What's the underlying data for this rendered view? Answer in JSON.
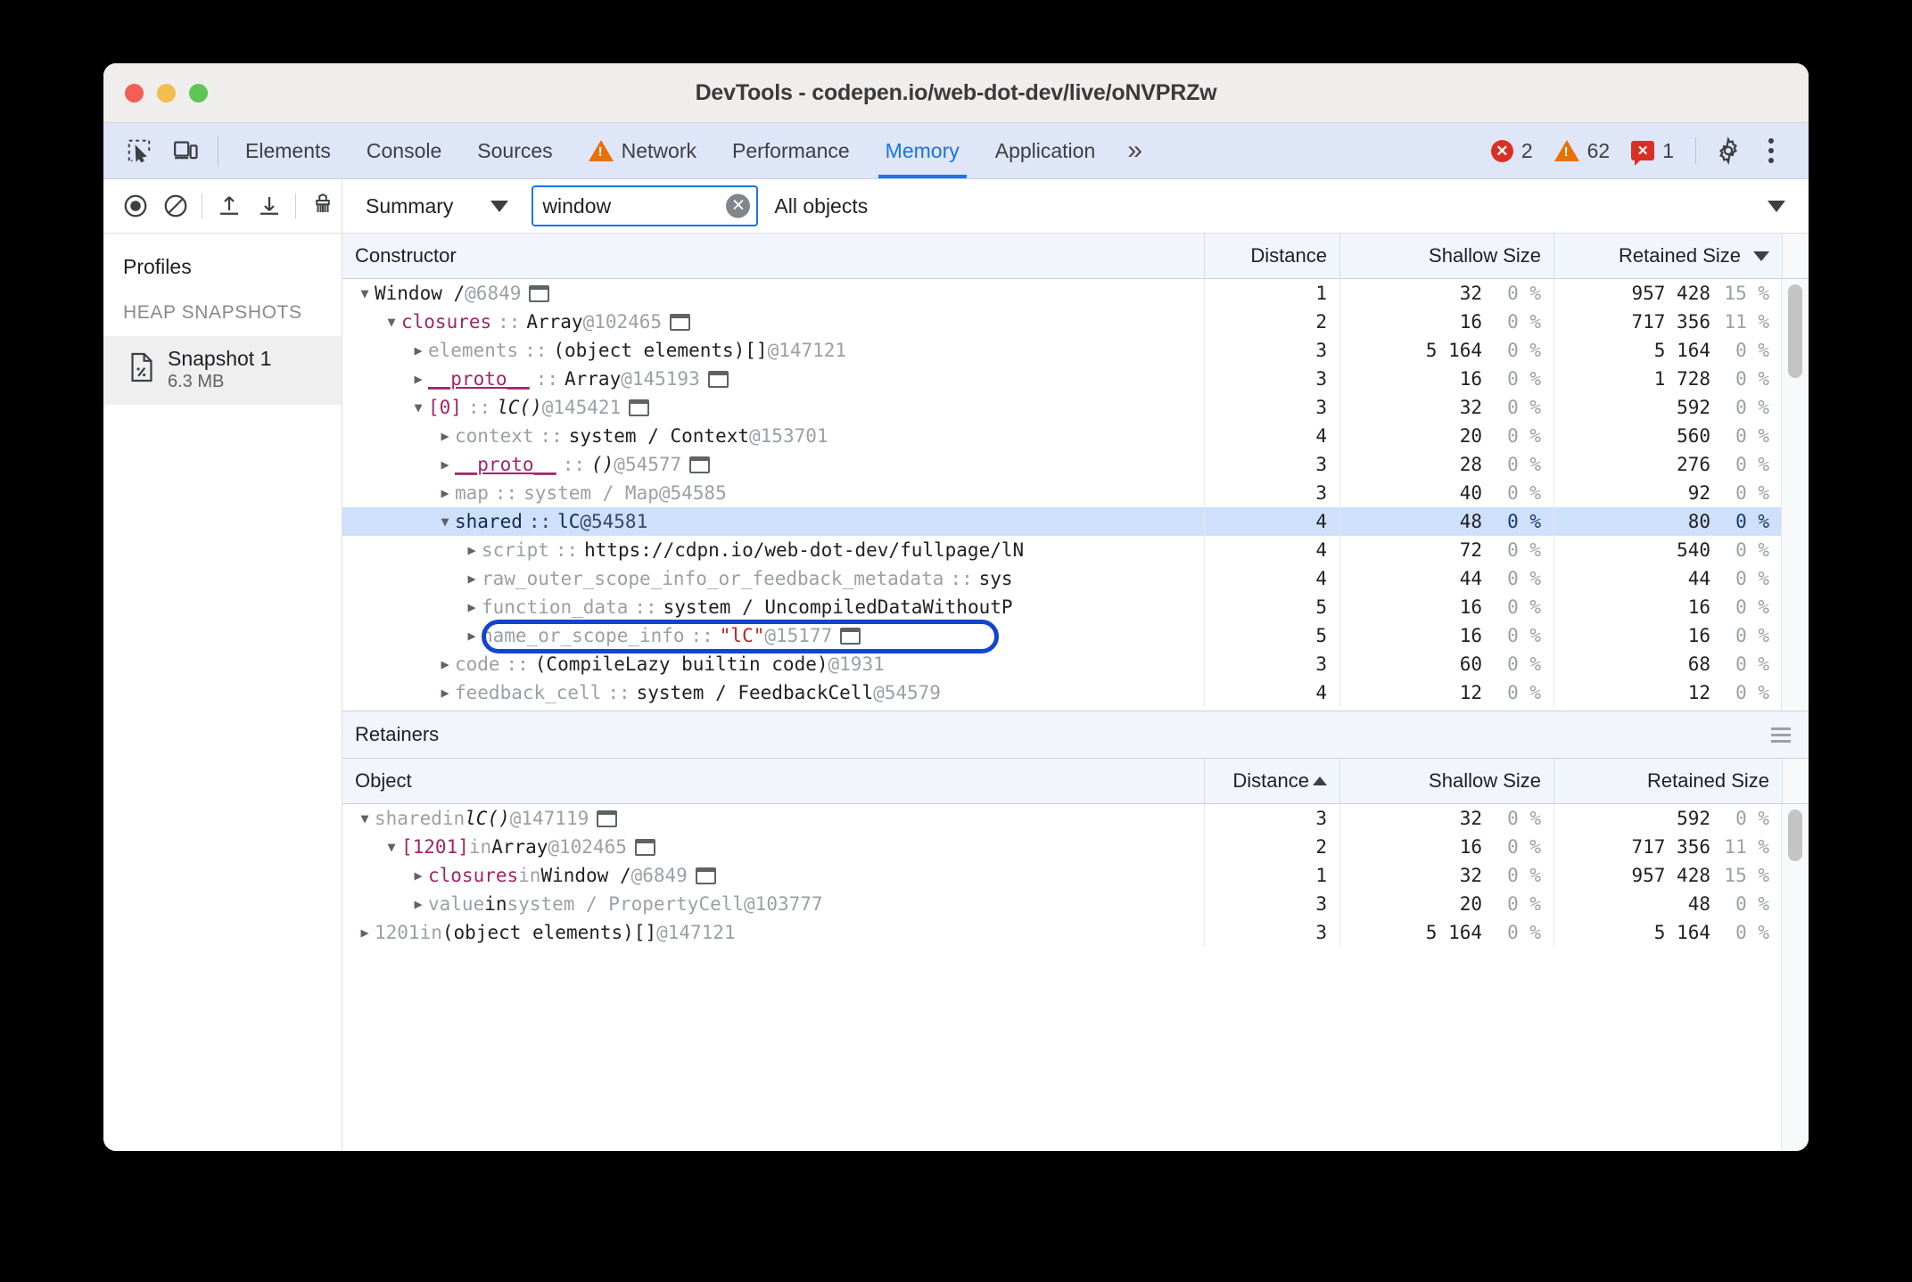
{
  "window": {
    "title": "DevTools - codepen.io/web-dot-dev/live/oNVPRZw",
    "traffic": {
      "close": "close-button",
      "minimize": "minimize-button",
      "maximize": "maximize-button"
    }
  },
  "tabbar": {
    "inspect_icon": "inspect-element-icon",
    "device_icon": "device-toolbar-icon",
    "tabs": [
      {
        "label": "Elements",
        "selected": false,
        "warning": false
      },
      {
        "label": "Console",
        "selected": false,
        "warning": false
      },
      {
        "label": "Sources",
        "selected": false,
        "warning": false
      },
      {
        "label": "Network",
        "selected": false,
        "warning": true
      },
      {
        "label": "Performance",
        "selected": false,
        "warning": false
      },
      {
        "label": "Memory",
        "selected": true,
        "warning": false
      },
      {
        "label": "Application",
        "selected": false,
        "warning": false
      }
    ],
    "more_tabs": "»",
    "counters": {
      "errors": "2",
      "warnings": "62",
      "issues": "1",
      "error_glyph": "✕",
      "warning_glyph": "!",
      "issue_glyph": "✕"
    },
    "settings_icon": "gear-icon",
    "menu_icon": "more-vertical-icon"
  },
  "sidebar": {
    "toolbar": {
      "record_icon": "record-heap-snapshot-icon",
      "clear_icon": "clear-all-icon",
      "load_icon": "load-profile-icon",
      "save_icon": "save-profile-icon",
      "collect_garbage_icon": "collect-garbage-icon"
    },
    "profiles_label": "Profiles",
    "section_title": "HEAP SNAPSHOTS",
    "snapshot": {
      "icon": "heap-snapshot-file-icon",
      "name": "Snapshot 1",
      "size": "6.3 MB"
    }
  },
  "heap_toolbar": {
    "view_select": {
      "value": "Summary",
      "caret": "chevron-down-icon"
    },
    "search": {
      "value": "window",
      "placeholder": "",
      "clear_icon": "clear-input-icon"
    },
    "objects_filter": {
      "value": "All objects",
      "caret": "chevron-down-icon"
    }
  },
  "constructor_grid": {
    "columns": {
      "constructor": "Constructor",
      "distance": "Distance",
      "shallow": "Shallow Size",
      "retained": "Retained Size"
    },
    "sort": {
      "column": "retained",
      "direction": "desc"
    },
    "rows": [
      {
        "indent": 0,
        "disc": "down",
        "parts": [
          {
            "t": "class",
            "v": "Window /"
          },
          {
            "t": "sp",
            "v": " "
          },
          {
            "t": "id",
            "v": "@6849"
          },
          {
            "t": "winbox",
            "v": ""
          }
        ],
        "distance": "1",
        "shallow": "32",
        "shallow_pct": "0 %",
        "retained": "957 428",
        "retained_pct": "15 %",
        "selected": false
      },
      {
        "indent": 1,
        "disc": "down",
        "parts": [
          {
            "t": "prop",
            "v": "closures"
          },
          {
            "t": "sep",
            "v": "::"
          },
          {
            "t": "class",
            "v": "Array"
          },
          {
            "t": "sp",
            "v": " "
          },
          {
            "t": "id",
            "v": "@102465"
          },
          {
            "t": "winbox",
            "v": ""
          }
        ],
        "distance": "2",
        "shallow": "16",
        "shallow_pct": "0 %",
        "retained": "717 356",
        "retained_pct": "11 %",
        "selected": false
      },
      {
        "indent": 2,
        "disc": "right",
        "parts": [
          {
            "t": "dim",
            "v": "elements"
          },
          {
            "t": "sep",
            "v": "::"
          },
          {
            "t": "class",
            "v": "(object elements)[]"
          },
          {
            "t": "sp",
            "v": " "
          },
          {
            "t": "id",
            "v": "@147121"
          }
        ],
        "distance": "3",
        "shallow": "5 164",
        "shallow_pct": "0 %",
        "retained": "5 164",
        "retained_pct": "0 %",
        "selected": false
      },
      {
        "indent": 2,
        "disc": "right",
        "parts": [
          {
            "t": "propu",
            "v": "__proto__"
          },
          {
            "t": "sep",
            "v": "::"
          },
          {
            "t": "class",
            "v": "Array"
          },
          {
            "t": "sp",
            "v": " "
          },
          {
            "t": "id",
            "v": "@145193"
          },
          {
            "t": "winbox",
            "v": ""
          }
        ],
        "distance": "3",
        "shallow": "16",
        "shallow_pct": "0 %",
        "retained": "1 728",
        "retained_pct": "0 %",
        "selected": false
      },
      {
        "indent": 2,
        "disc": "down",
        "parts": [
          {
            "t": "prop",
            "v": "[0]"
          },
          {
            "t": "sep",
            "v": "::"
          },
          {
            "t": "italic",
            "v": "lC()"
          },
          {
            "t": "sp",
            "v": " "
          },
          {
            "t": "id",
            "v": "@145421"
          },
          {
            "t": "winbox",
            "v": ""
          }
        ],
        "distance": "3",
        "shallow": "32",
        "shallow_pct": "0 %",
        "retained": "592",
        "retained_pct": "0 %",
        "selected": false
      },
      {
        "indent": 3,
        "disc": "right",
        "parts": [
          {
            "t": "dim",
            "v": "context"
          },
          {
            "t": "sep",
            "v": "::"
          },
          {
            "t": "class",
            "v": "system / Context"
          },
          {
            "t": "sp",
            "v": " "
          },
          {
            "t": "id",
            "v": "@153701"
          }
        ],
        "distance": "4",
        "shallow": "20",
        "shallow_pct": "0 %",
        "retained": "560",
        "retained_pct": "0 %",
        "selected": false
      },
      {
        "indent": 3,
        "disc": "right",
        "parts": [
          {
            "t": "propu",
            "v": "__proto__"
          },
          {
            "t": "sep",
            "v": "::"
          },
          {
            "t": "italic",
            "v": "()"
          },
          {
            "t": "sp",
            "v": " "
          },
          {
            "t": "id",
            "v": "@54577"
          },
          {
            "t": "winbox",
            "v": ""
          }
        ],
        "distance": "3",
        "shallow": "28",
        "shallow_pct": "0 %",
        "retained": "276",
        "retained_pct": "0 %",
        "selected": false
      },
      {
        "indent": 3,
        "disc": "right",
        "parts": [
          {
            "t": "dim",
            "v": "map"
          },
          {
            "t": "sep",
            "v": "::"
          },
          {
            "t": "dim",
            "v": "system / Map"
          },
          {
            "t": "sp",
            "v": " "
          },
          {
            "t": "id",
            "v": "@54585"
          }
        ],
        "distance": "3",
        "shallow": "40",
        "shallow_pct": "0 %",
        "retained": "92",
        "retained_pct": "0 %",
        "selected": false
      },
      {
        "indent": 3,
        "disc": "down",
        "parts": [
          {
            "t": "dark",
            "v": "shared"
          },
          {
            "t": "sep",
            "v": "::"
          },
          {
            "t": "dark",
            "v": "lC"
          },
          {
            "t": "sp",
            "v": " "
          },
          {
            "t": "id",
            "v": "@54581"
          }
        ],
        "distance": "4",
        "shallow": "48",
        "shallow_pct": "0 %",
        "retained": "80",
        "retained_pct": "0 %",
        "selected": true
      },
      {
        "indent": 4,
        "disc": "right",
        "parts": [
          {
            "t": "dim",
            "v": "script"
          },
          {
            "t": "sep",
            "v": "::"
          },
          {
            "t": "class",
            "v": "https://cdpn.io/web-dot-dev/fullpage/lN"
          }
        ],
        "distance": "4",
        "shallow": "72",
        "shallow_pct": "0 %",
        "retained": "540",
        "retained_pct": "0 %",
        "selected": false
      },
      {
        "indent": 4,
        "disc": "right",
        "parts": [
          {
            "t": "dim",
            "v": "raw_outer_scope_info_or_feedback_metadata"
          },
          {
            "t": "sep",
            "v": "::"
          },
          {
            "t": "class",
            "v": "sys"
          }
        ],
        "distance": "4",
        "shallow": "44",
        "shallow_pct": "0 %",
        "retained": "44",
        "retained_pct": "0 %",
        "selected": false
      },
      {
        "indent": 4,
        "disc": "right",
        "parts": [
          {
            "t": "dim",
            "v": "function_data"
          },
          {
            "t": "sep",
            "v": "::"
          },
          {
            "t": "class",
            "v": "system / UncompiledDataWithoutP"
          }
        ],
        "distance": "5",
        "shallow": "16",
        "shallow_pct": "0 %",
        "retained": "16",
        "retained_pct": "0 %",
        "selected": false
      },
      {
        "indent": 4,
        "disc": "right",
        "highlighted": true,
        "parts": [
          {
            "t": "dim",
            "v": "name_or_scope_info"
          },
          {
            "t": "sep",
            "v": "::"
          },
          {
            "t": "str",
            "v": "\"lC\""
          },
          {
            "t": "sp",
            "v": " "
          },
          {
            "t": "id",
            "v": "@15177"
          },
          {
            "t": "winbox",
            "v": ""
          }
        ],
        "distance": "5",
        "shallow": "16",
        "shallow_pct": "0 %",
        "retained": "16",
        "retained_pct": "0 %",
        "selected": false
      },
      {
        "indent": 3,
        "disc": "right",
        "parts": [
          {
            "t": "dim",
            "v": "code"
          },
          {
            "t": "sep",
            "v": "::"
          },
          {
            "t": "class",
            "v": "(CompileLazy builtin code)"
          },
          {
            "t": "sp",
            "v": " "
          },
          {
            "t": "id",
            "v": "@1931"
          }
        ],
        "distance": "3",
        "shallow": "60",
        "shallow_pct": "0 %",
        "retained": "68",
        "retained_pct": "0 %",
        "selected": false
      },
      {
        "indent": 3,
        "disc": "right",
        "parts": [
          {
            "t": "dim",
            "v": "feedback_cell"
          },
          {
            "t": "sep",
            "v": "::"
          },
          {
            "t": "class",
            "v": "system / FeedbackCell"
          },
          {
            "t": "sp",
            "v": " "
          },
          {
            "t": "id",
            "v": "@54579"
          }
        ],
        "distance": "4",
        "shallow": "12",
        "shallow_pct": "0 %",
        "retained": "12",
        "retained_pct": "0 %",
        "selected": false
      }
    ]
  },
  "retainers": {
    "title": "Retainers",
    "menu_icon": "hamburger-menu-icon",
    "columns": {
      "object": "Object",
      "distance": "Distance",
      "shallow": "Shallow Size",
      "retained": "Retained Size"
    },
    "sort": {
      "column": "distance",
      "direction": "asc"
    },
    "rows": [
      {
        "indent": 0,
        "disc": "down",
        "parts": [
          {
            "t": "dim",
            "v": "shared"
          },
          {
            "t": "sp",
            "v": " "
          },
          {
            "t": "dim",
            "v": "in"
          },
          {
            "t": "sp",
            "v": " "
          },
          {
            "t": "italic",
            "v": "lC()"
          },
          {
            "t": "sp",
            "v": " "
          },
          {
            "t": "id",
            "v": "@147119"
          },
          {
            "t": "winbox",
            "v": ""
          }
        ],
        "distance": "3",
        "shallow": "32",
        "shallow_pct": "0 %",
        "retained": "592",
        "retained_pct": "0 %"
      },
      {
        "indent": 1,
        "disc": "down",
        "parts": [
          {
            "t": "prop",
            "v": "[1201]"
          },
          {
            "t": "sp",
            "v": " "
          },
          {
            "t": "dim",
            "v": "in"
          },
          {
            "t": "sp",
            "v": " "
          },
          {
            "t": "class",
            "v": "Array"
          },
          {
            "t": "sp",
            "v": " "
          },
          {
            "t": "id",
            "v": "@102465"
          },
          {
            "t": "winbox",
            "v": ""
          }
        ],
        "distance": "2",
        "shallow": "16",
        "shallow_pct": "0 %",
        "retained": "717 356",
        "retained_pct": "11 %"
      },
      {
        "indent": 2,
        "disc": "right",
        "parts": [
          {
            "t": "prop",
            "v": "closures"
          },
          {
            "t": "sp",
            "v": " "
          },
          {
            "t": "dim",
            "v": "in"
          },
          {
            "t": "sp",
            "v": " "
          },
          {
            "t": "class",
            "v": "Window /"
          },
          {
            "t": "sp",
            "v": " "
          },
          {
            "t": "id",
            "v": "@6849"
          },
          {
            "t": "winbox",
            "v": ""
          }
        ],
        "distance": "1",
        "shallow": "32",
        "shallow_pct": "0 %",
        "retained": "957 428",
        "retained_pct": "15 %"
      },
      {
        "indent": 2,
        "disc": "right",
        "parts": [
          {
            "t": "dim",
            "v": "value"
          },
          {
            "t": "sp",
            "v": " "
          },
          {
            "t": "dark",
            "v": "in"
          },
          {
            "t": "sp",
            "v": " "
          },
          {
            "t": "dim",
            "v": "system / PropertyCell"
          },
          {
            "t": "sp",
            "v": " "
          },
          {
            "t": "id",
            "v": "@103777"
          }
        ],
        "distance": "3",
        "shallow": "20",
        "shallow_pct": "0 %",
        "retained": "48",
        "retained_pct": "0 %"
      },
      {
        "indent": 0,
        "disc": "right",
        "parts": [
          {
            "t": "dim",
            "v": "1201"
          },
          {
            "t": "sp",
            "v": " "
          },
          {
            "t": "dim",
            "v": "in"
          },
          {
            "t": "sp",
            "v": " "
          },
          {
            "t": "class",
            "v": "(object elements)[]"
          },
          {
            "t": "sp",
            "v": " "
          },
          {
            "t": "id",
            "v": "@147121"
          }
        ],
        "distance": "3",
        "shallow": "5 164",
        "shallow_pct": "0 %",
        "retained": "5 164",
        "retained_pct": "0 %"
      }
    ]
  },
  "colors": {
    "accent": "#1a73e8",
    "tabbar_bg": "#dfe6f7",
    "selected_row": "#cfe0fb",
    "highlight_ring": "#1344d1",
    "error_red": "#d93025",
    "warning_orange": "#e8710a",
    "property_magenta": "#a3246a",
    "string_red": "#c5221f"
  }
}
